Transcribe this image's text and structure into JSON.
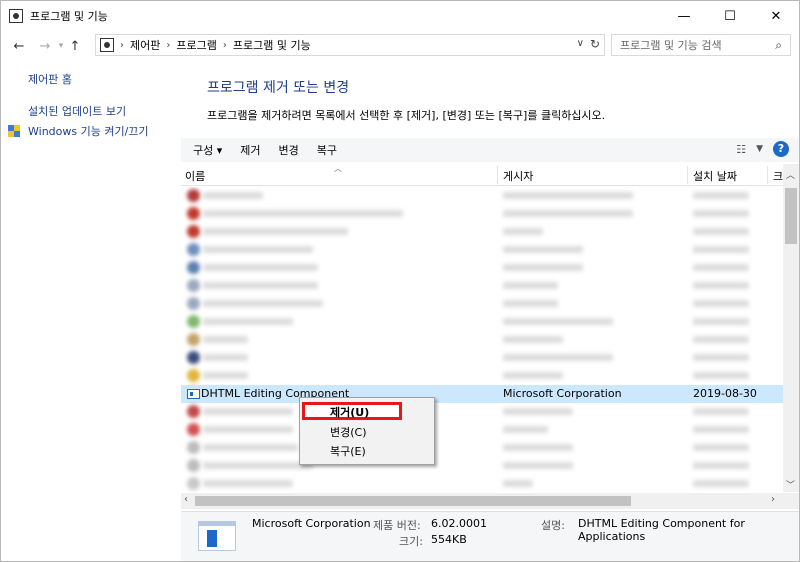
{
  "window": {
    "title": "프로그램 및 기능",
    "controls": {
      "minimize": "—",
      "maximize": "☐",
      "close": "✕"
    }
  },
  "address": {
    "breadcrumbs": [
      "제어판",
      "프로그램",
      "프로그램 및 기능"
    ],
    "search_placeholder": "프로그램 및 기능 검색"
  },
  "sidebar": {
    "items": [
      {
        "label": "제어판 홈"
      },
      {
        "label": "설치된 업데이트 보기"
      },
      {
        "label": "Windows 기능 켜기/끄기"
      }
    ]
  },
  "main": {
    "title": "프로그램 제거 또는 변경",
    "description": "프로그램을 제거하려면 목록에서 선택한 후 [제거], [변경] 또는 [복구]를 클릭하십시오."
  },
  "toolbar": {
    "organize": "구성 ▾",
    "uninstall": "제거",
    "change": "변경",
    "repair": "복구"
  },
  "columns": {
    "name": "이름",
    "publisher": "게시자",
    "installed": "설치 날짜",
    "size": "크"
  },
  "selected_row": {
    "name": "DHTML Editing Component",
    "publisher": "Microsoft Corporation",
    "date": "2019-08-30"
  },
  "context_menu": {
    "uninstall": "제거(U)",
    "change": "변경(C)",
    "repair": "복구(E)"
  },
  "details": {
    "publisher": "Microsoft Corporation",
    "version_label": "제품 버전:",
    "version": "6.02.0001",
    "size_label": "크기:",
    "size": "554KB",
    "desc_label": "설명:",
    "desc": "DHTML Editing Component for Applications"
  },
  "colors": {
    "link": "#1e3e8c",
    "selection": "#cce8ff",
    "highlight": "#e8151b"
  }
}
